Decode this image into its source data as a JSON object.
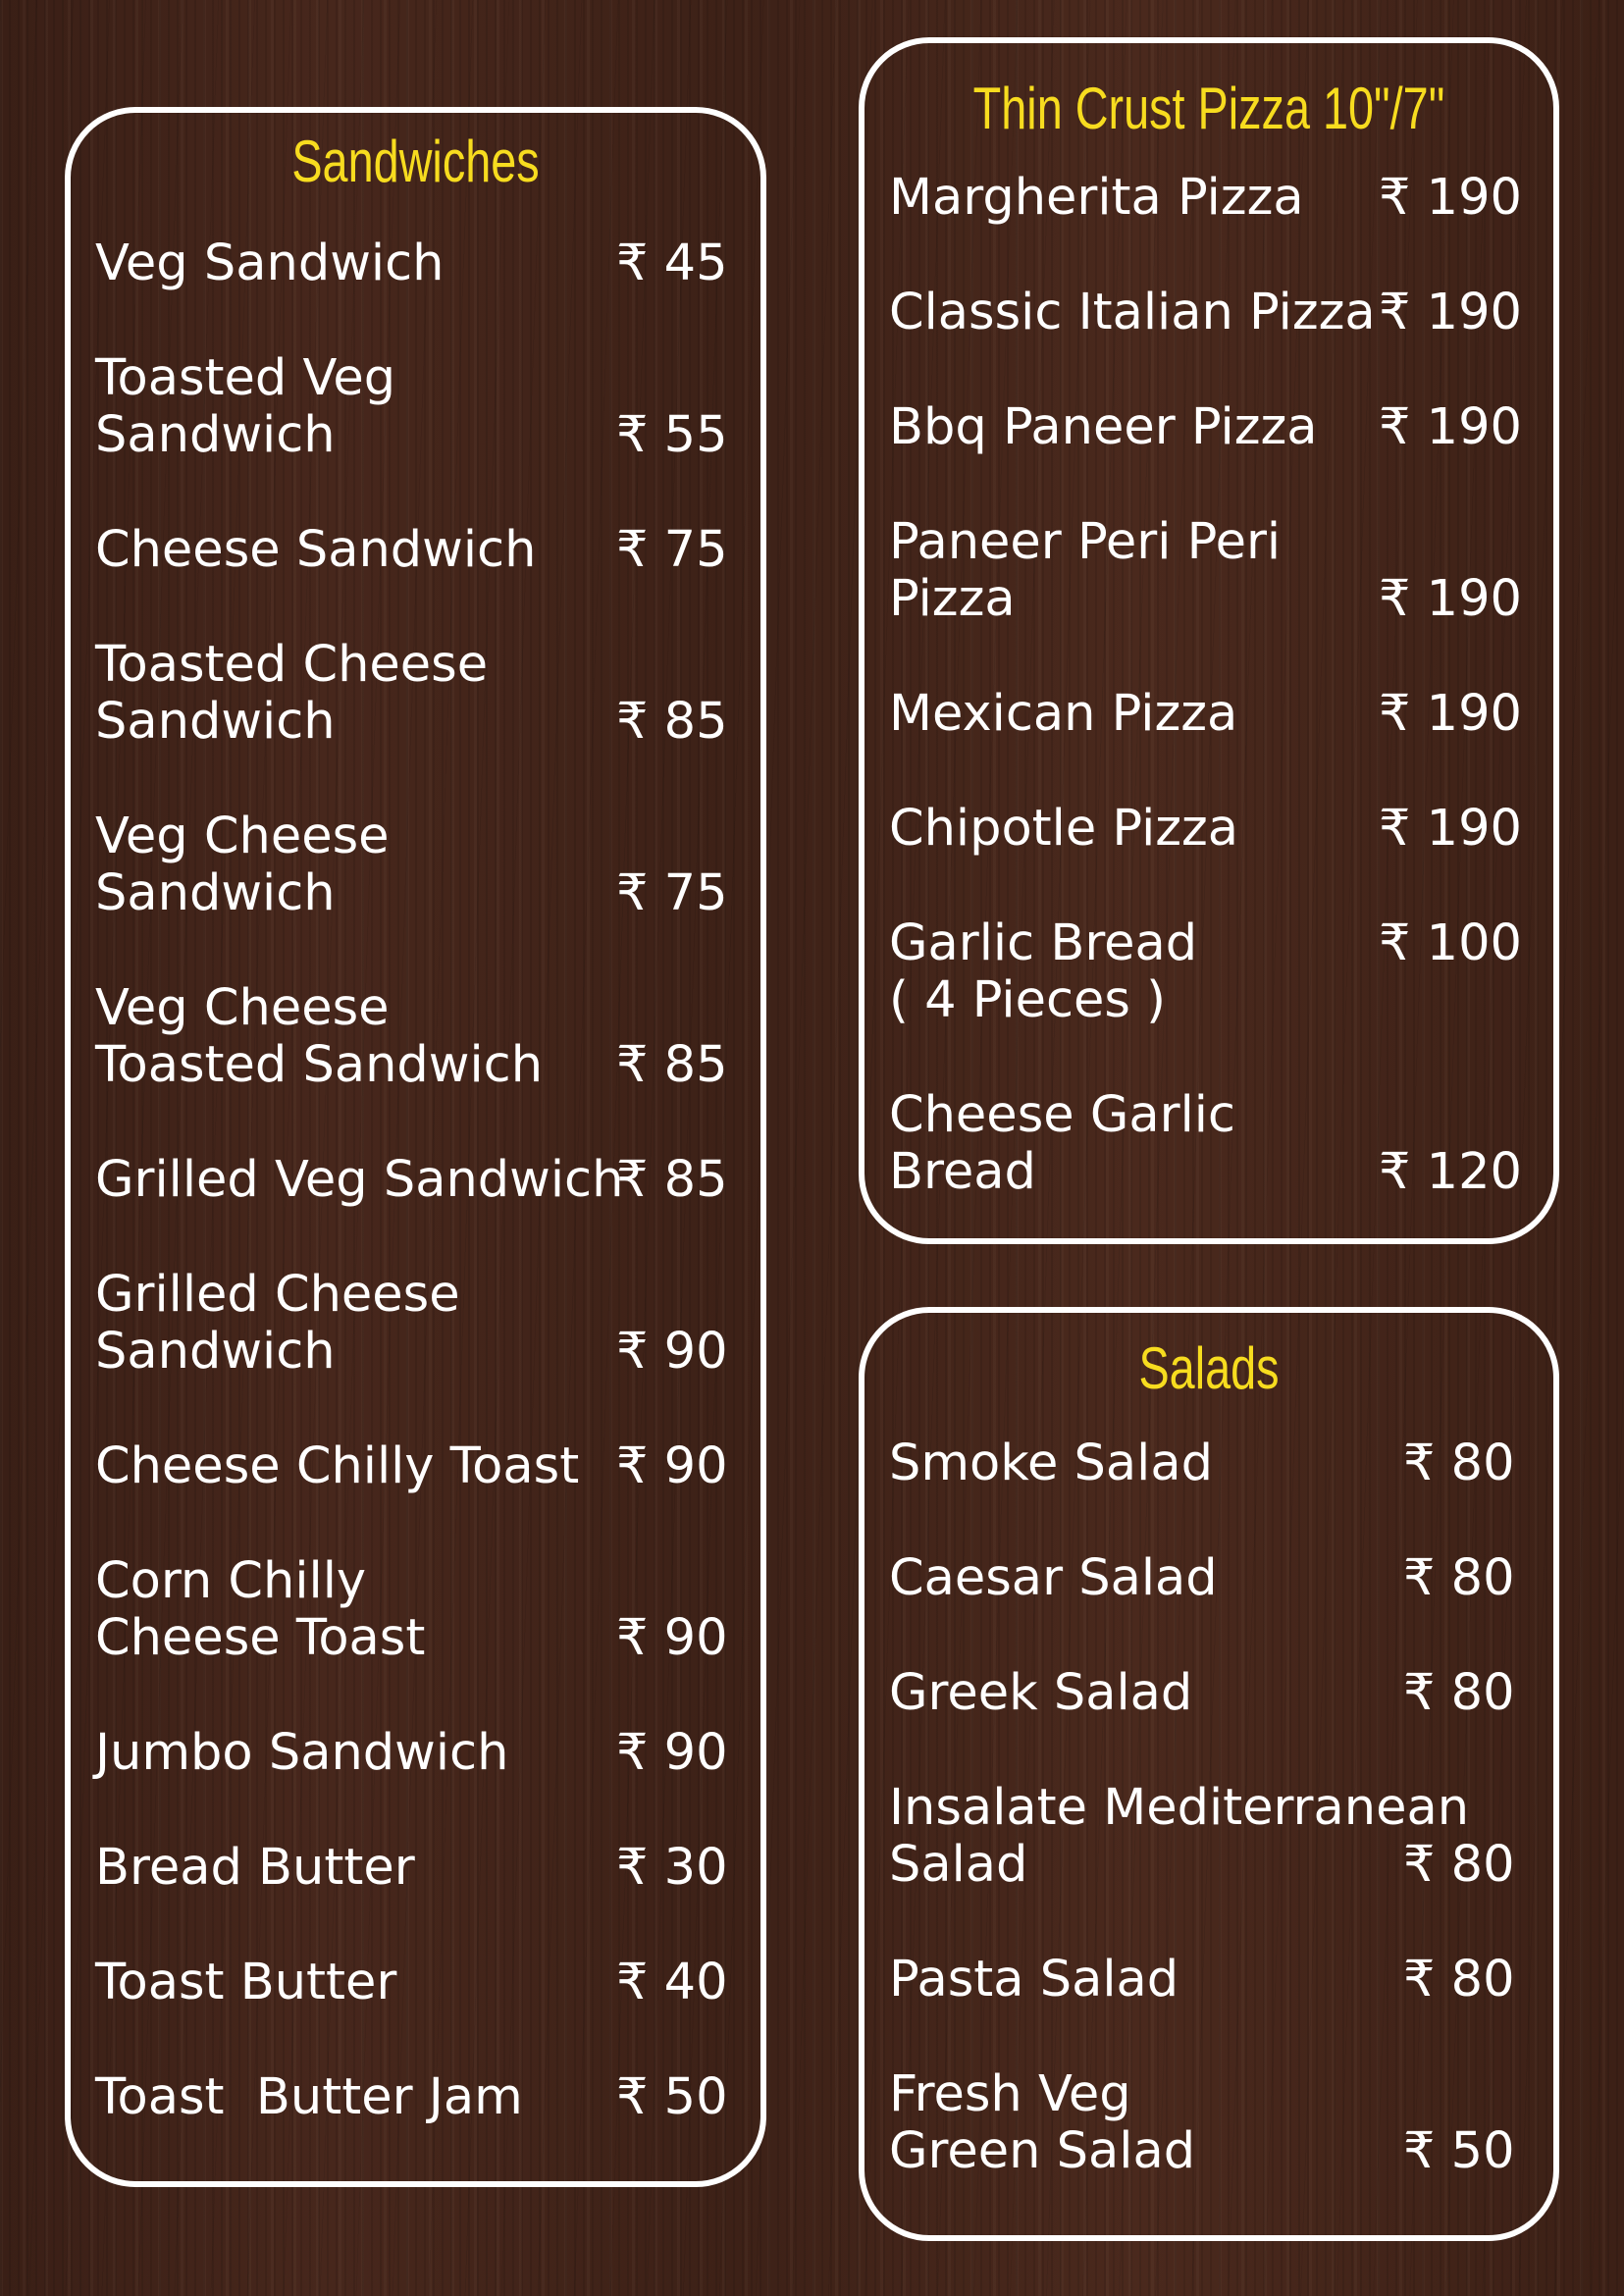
{
  "sections": [
    {
      "id": "sandwiches",
      "title": "Sandwiches",
      "items": [
        {
          "name": "Veg Sandwich",
          "price": "₹ 45"
        },
        {
          "name": "Toasted Veg\nSandwich",
          "price": "₹ 55"
        },
        {
          "name": "Cheese Sandwich",
          "price": "₹ 75"
        },
        {
          "name": "Toasted Cheese\nSandwich",
          "price": "₹ 85"
        },
        {
          "name": "Veg Cheese\nSandwich",
          "price": "₹ 75"
        },
        {
          "name": "Veg Cheese\nToasted Sandwich",
          "price": "₹ 85"
        },
        {
          "name": "Grilled Veg Sandwich",
          "price": "₹ 85"
        },
        {
          "name": "Grilled Cheese\nSandwich",
          "price": "₹ 90"
        },
        {
          "name": "Cheese Chilly Toast",
          "price": "₹ 90"
        },
        {
          "name": "Corn Chilly\nCheese Toast",
          "price": "₹ 90"
        },
        {
          "name": "Jumbo Sandwich",
          "price": "₹ 90"
        },
        {
          "name": "Bread Butter",
          "price": "₹ 30"
        },
        {
          "name": "Toast Butter",
          "price": "₹ 40"
        },
        {
          "name": "Toast  Butter Jam",
          "price": "₹ 50"
        }
      ]
    },
    {
      "id": "pizza",
      "title": "Thin Crust Pizza 10\"/7\"",
      "items": [
        {
          "name": "Margherita Pizza",
          "price": "₹ 190"
        },
        {
          "name": "Classic Italian Pizza",
          "price": "₹ 190"
        },
        {
          "name": "Bbq Paneer Pizza",
          "price": "₹ 190"
        },
        {
          "name": "Paneer Peri Peri\nPizza",
          "price": "₹ 190"
        },
        {
          "name": "Mexican Pizza",
          "price": "₹ 190"
        },
        {
          "name": "Chipotle Pizza",
          "price": "₹ 190"
        },
        {
          "name": "Garlic Bread\n( 4 Pieces )",
          "price": "₹ 100"
        },
        {
          "name": "Cheese Garlic\nBread",
          "price": "₹ 120"
        }
      ]
    },
    {
      "id": "salads",
      "title": "Salads",
      "items": [
        {
          "name": "Smoke Salad",
          "price": "₹ 80"
        },
        {
          "name": "Caesar Salad",
          "price": "₹ 80"
        },
        {
          "name": "Greek Salad",
          "price": "₹ 80"
        },
        {
          "name": "Insalate Mediterranean\nSalad",
          "price": "₹ 80"
        },
        {
          "name": "Pasta Salad",
          "price": "₹ 80"
        },
        {
          "name": "Fresh Veg\nGreen Salad",
          "price": "₹ 50"
        }
      ]
    }
  ],
  "colors": {
    "title": "#f7dc1f",
    "text": "#ffffff",
    "border": "#ffffff",
    "background": "#3f2218"
  }
}
